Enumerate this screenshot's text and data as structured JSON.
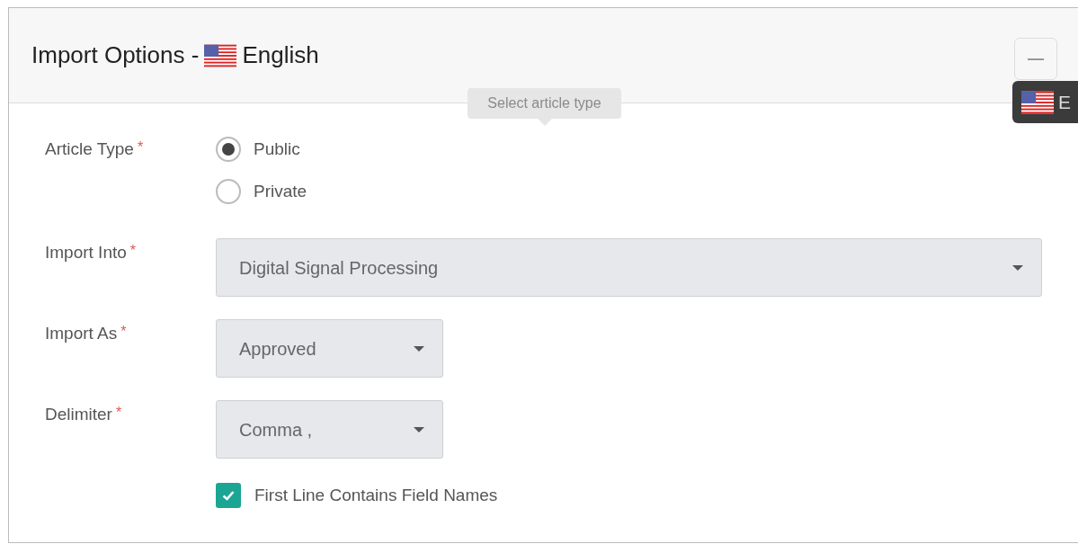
{
  "panel": {
    "title": "Import Options -",
    "language": "English"
  },
  "language_badge": {
    "text": "E"
  },
  "tooltip": {
    "text": "Select article type"
  },
  "fields": [
    {
      "kind": "radio",
      "label": "Article Type",
      "required_mark": "*",
      "options": [
        {
          "label": "Public",
          "selected": true
        },
        {
          "label": "Private",
          "selected": false
        }
      ]
    },
    {
      "kind": "select",
      "label": "Import Into",
      "required_mark": "*",
      "value": "Digital Signal Processing",
      "wide": true
    },
    {
      "kind": "select",
      "label": "Import As",
      "required_mark": "*",
      "value": "Approved",
      "wide": false
    },
    {
      "kind": "select",
      "label": "Delimiter",
      "required_mark": "*",
      "value": "Comma ,",
      "wide": false
    },
    {
      "kind": "checkbox",
      "label": "First Line Contains Field Names",
      "checked": true
    }
  ]
}
